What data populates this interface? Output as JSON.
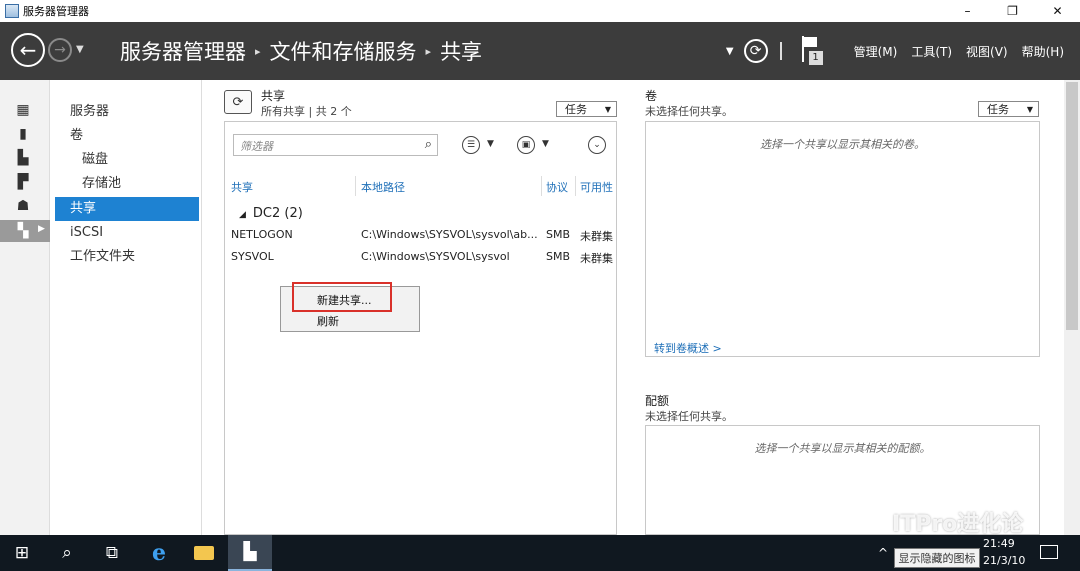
{
  "window": {
    "title": "服务器管理器",
    "minimize_glyph": "–",
    "maximize_glyph": "❐",
    "close_glyph": "✕"
  },
  "header": {
    "breadcrumb": [
      "服务器管理器",
      "文件和存储服务",
      "共享"
    ],
    "flag_count": "1",
    "menu": [
      "管理(M)",
      "工具(T)",
      "视图(V)",
      "帮助(H)"
    ]
  },
  "nav": {
    "items": [
      {
        "label": "服务器",
        "level": 0,
        "selected": false
      },
      {
        "label": "卷",
        "level": 0,
        "selected": false
      },
      {
        "label": "磁盘",
        "level": 1,
        "selected": false
      },
      {
        "label": "存储池",
        "level": 1,
        "selected": false
      },
      {
        "label": "共享",
        "level": 0,
        "selected": true
      },
      {
        "label": "iSCSI",
        "level": 0,
        "selected": false
      },
      {
        "label": "工作文件夹",
        "level": 0,
        "selected": false
      }
    ]
  },
  "shares": {
    "title": "共享",
    "subtitle": "所有共享 | 共 2 个",
    "tasks_label": "任务",
    "filter_placeholder": "筛选器",
    "columns": [
      "共享",
      "本地路径",
      "协议",
      "可用性"
    ],
    "group": "DC2 (2)",
    "rows": [
      {
        "name": "NETLOGON",
        "path": "C:\\Windows\\SYSVOL\\sysvol\\ab...",
        "protocol": "SMB",
        "availability": "未群集"
      },
      {
        "name": "SYSVOL",
        "path": "C:\\Windows\\SYSVOL\\sysvol",
        "protocol": "SMB",
        "availability": "未群集"
      }
    ]
  },
  "context_menu": {
    "items": [
      "新建共享...",
      "刷新"
    ]
  },
  "volume": {
    "title": "卷",
    "subtitle": "未选择任何共享。",
    "tasks_label": "任务",
    "hint": "选择一个共享以显示其相关的卷。",
    "link": "转到卷概述 >"
  },
  "quota": {
    "title": "配额",
    "subtitle": "未选择任何共享。",
    "hint": "选择一个共享以显示其相关的配额。"
  },
  "taskbar": {
    "time": "21:49",
    "date": "21/3/10",
    "tooltip": "显示隐藏的图标"
  },
  "watermark": "ITPro进化论"
}
